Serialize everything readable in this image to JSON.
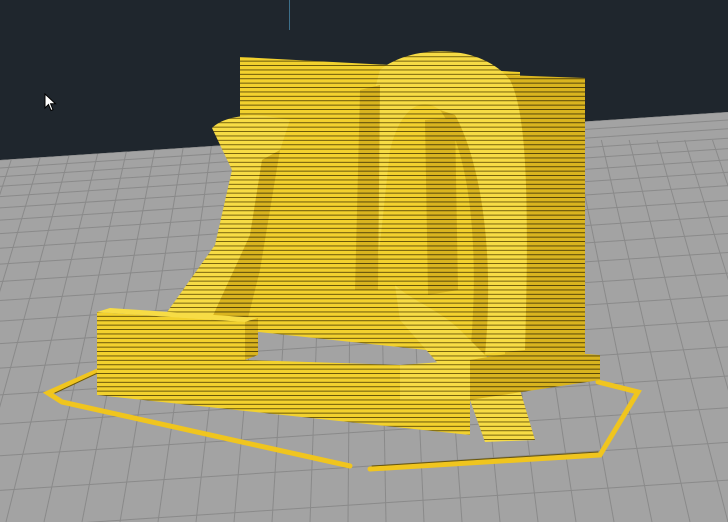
{
  "viewport": {
    "background_color": "#1f262d",
    "build_plate_color": "#a3a3a3",
    "grid_line_color": "#8a8a8a",
    "model_color": "#f2d12e",
    "layer_line_color": "#5c4b06",
    "skirt_color": "#f0c51e"
  },
  "cursor": {
    "icon": "arrow-pointer-icon"
  }
}
